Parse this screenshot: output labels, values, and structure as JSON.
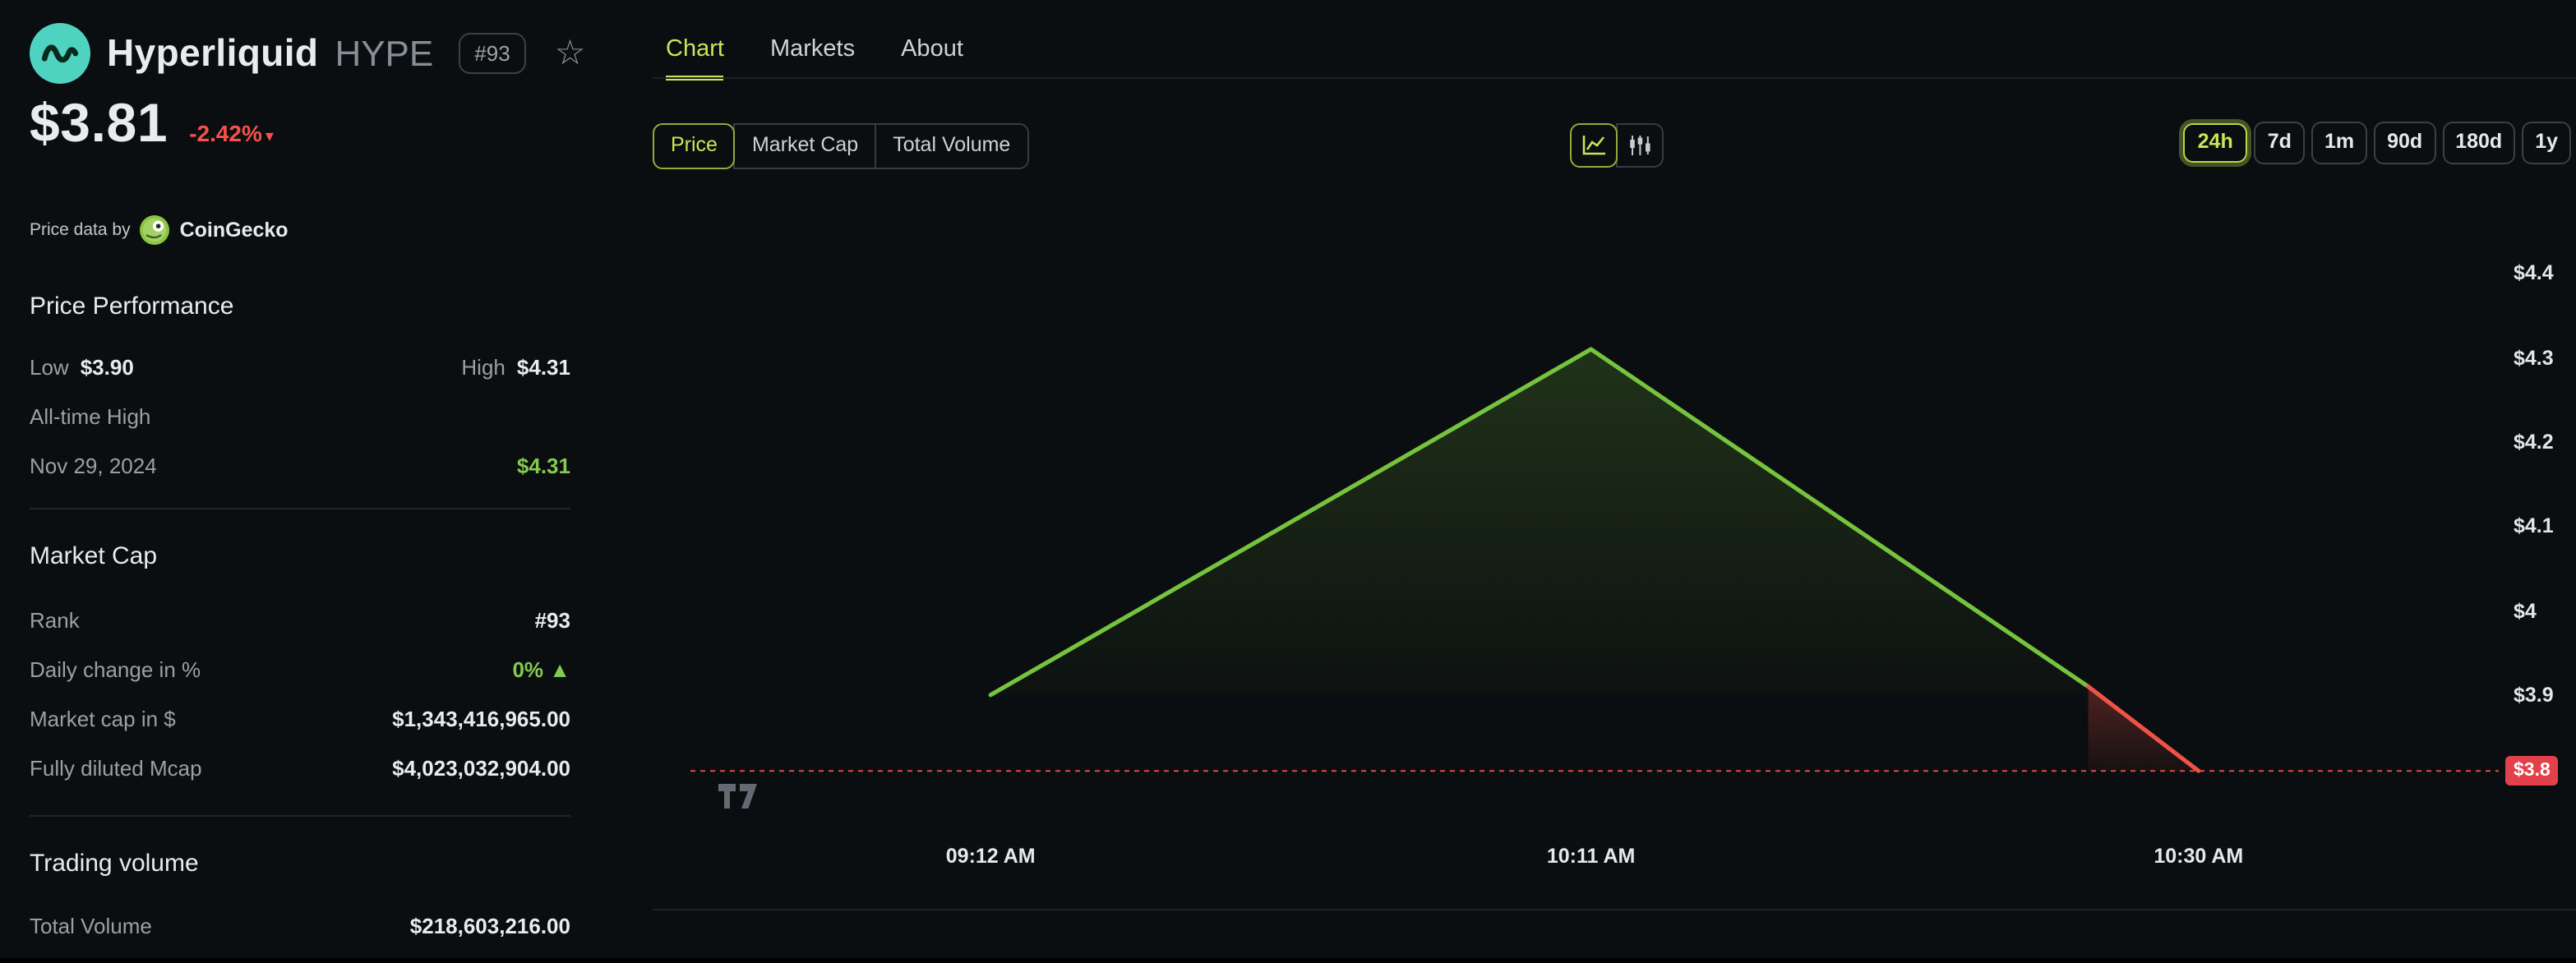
{
  "colors": {
    "bg": "#0b0e10",
    "text": "#e9ebec",
    "muted": "#99a0a6",
    "divider": "#20252a",
    "accent_lime": "#cbe457",
    "lime_border": "#a9cf45",
    "chart_green": "#76c33e",
    "chart_red": "#ef5348",
    "price_red": "#f4524c",
    "badge_red": "#e2414b",
    "value_green": "#84ca4f",
    "logo_teal": "#4fd3c0",
    "gecko_green": "#8bc53f"
  },
  "sidebar": {
    "coin": {
      "name": "Hyperliquid",
      "symbol": "HYPE",
      "rank_badge": "#93",
      "favorite_icon": "☆"
    },
    "price": "$3.81",
    "change": "-2.42%",
    "change_arrow": "▾",
    "attribution": {
      "prefix": "Price data by",
      "source": "CoinGecko"
    },
    "price_performance": {
      "title": "Price Performance",
      "low_label": "Low",
      "low_value": "$3.90",
      "high_label": "High",
      "high_value": "$4.31",
      "ath_label": "All-time High",
      "ath_date": "Nov 29, 2024",
      "ath_value": "$4.31"
    },
    "market_cap": {
      "title": "Market Cap",
      "rows": [
        {
          "label": "Rank",
          "value": "#93",
          "green": false
        },
        {
          "label": "Daily change in %",
          "value": "0% ▲",
          "green": true
        },
        {
          "label": "Market cap in $",
          "value": "$1,343,416,965.00",
          "green": false
        },
        {
          "label": "Fully diluted Mcap",
          "value": "$4,023,032,904.00",
          "green": false
        }
      ]
    },
    "trading_volume": {
      "title": "Trading volume",
      "rows": [
        {
          "label": "Total Volume",
          "value": "$218,603,216.00",
          "green": false
        }
      ]
    }
  },
  "main": {
    "tabs": [
      {
        "label": "Chart",
        "active": true
      },
      {
        "label": "Markets",
        "active": false
      },
      {
        "label": "About",
        "active": false
      }
    ],
    "metric_buttons": [
      {
        "label": "Price",
        "active": true
      },
      {
        "label": "Market Cap",
        "active": false
      },
      {
        "label": "Total Volume",
        "active": false
      }
    ],
    "chart_type_buttons": [
      {
        "name": "line",
        "active": true
      },
      {
        "name": "candlestick",
        "active": false
      }
    ],
    "range_buttons": [
      {
        "label": "24h",
        "active": true
      },
      {
        "label": "7d",
        "active": false
      },
      {
        "label": "1m",
        "active": false
      },
      {
        "label": "90d",
        "active": false
      },
      {
        "label": "180d",
        "active": false
      },
      {
        "label": "1y",
        "active": false
      }
    ]
  },
  "chart_data": {
    "type": "line",
    "title": "Hyperliquid (HYPE) price — 24h",
    "x_ticks": [
      "09:12 AM",
      "10:11 AM",
      "10:30 AM"
    ],
    "x_tick_xf": [
      0.166,
      0.498,
      0.834
    ],
    "y_ticks": [
      {
        "label": "$4.4",
        "value": 4.4
      },
      {
        "label": "$4.3",
        "value": 4.3
      },
      {
        "label": "$4.2",
        "value": 4.2
      },
      {
        "label": "$4.1",
        "value": 4.1
      },
      {
        "label": "$4",
        "value": 4.0
      },
      {
        "label": "$3.9",
        "value": 3.9
      },
      {
        "label": "$3.8",
        "value": 3.8
      }
    ],
    "ylim": [
      3.74,
      4.5
    ],
    "current_price": 3.81,
    "current_price_label": "$3.8",
    "baseline_value": 3.9,
    "red_from_index": 2,
    "points": [
      {
        "xf": 0.166,
        "value": 3.9,
        "time": "09:12 AM"
      },
      {
        "xf": 0.498,
        "value": 4.31,
        "time": "10:11 AM"
      },
      {
        "xf": 0.773,
        "value": 3.91
      },
      {
        "xf": 0.834,
        "value": 3.81,
        "time": "10:30 AM"
      }
    ],
    "grid": false,
    "legend": "none"
  }
}
